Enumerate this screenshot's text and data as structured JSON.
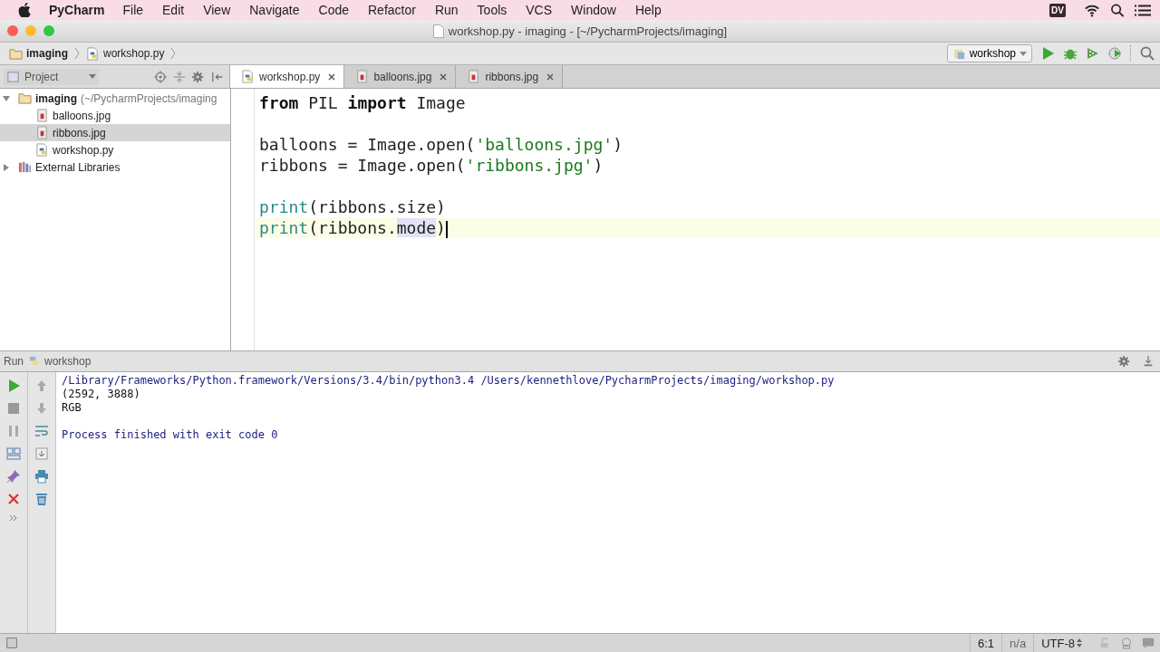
{
  "menu_bar": {
    "app": "PyCharm",
    "items": [
      "File",
      "Edit",
      "View",
      "Navigate",
      "Code",
      "Refactor",
      "Run",
      "Tools",
      "VCS",
      "Window",
      "Help"
    ],
    "badge": "DV"
  },
  "window": {
    "title": "workshop.py - imaging - [~/PycharmProjects/imaging]"
  },
  "breadcrumbs": [
    {
      "label": "imaging",
      "kind": "folder"
    },
    {
      "label": "workshop.py",
      "kind": "python"
    }
  ],
  "run_config": {
    "label": "workshop"
  },
  "project_panel": {
    "title": "Project"
  },
  "tabs": [
    {
      "label": "workshop.py",
      "kind": "python",
      "selected": true
    },
    {
      "label": "balloons.jpg",
      "kind": "image",
      "selected": false
    },
    {
      "label": "ribbons.jpg",
      "kind": "image",
      "selected": false
    }
  ],
  "tree": [
    {
      "label": "imaging",
      "path": "(~/PycharmProjects/imaging",
      "kind": "folder",
      "expanded": true,
      "selected": false,
      "children": [
        {
          "label": "balloons.jpg",
          "kind": "image",
          "selected": false
        },
        {
          "label": "ribbons.jpg",
          "kind": "image",
          "selected": true
        },
        {
          "label": "workshop.py",
          "kind": "python",
          "selected": false
        }
      ]
    },
    {
      "label": "External Libraries",
      "kind": "library",
      "expanded": false,
      "selected": false
    }
  ],
  "code_lines": [
    {
      "kind": "code",
      "current": false,
      "tokens": [
        {
          "text": "from",
          "kind": "keyword"
        },
        {
          "text": " PIL ",
          "kind": "plain"
        },
        {
          "text": "import",
          "kind": "keyword"
        },
        {
          "text": " Image",
          "kind": "plain"
        }
      ]
    },
    {
      "kind": "blank",
      "current": false
    },
    {
      "kind": "code",
      "current": false,
      "tokens": [
        {
          "text": "balloons = Image.open(",
          "kind": "plain"
        },
        {
          "text": "'balloons.jpg'",
          "kind": "string"
        },
        {
          "text": ")",
          "kind": "plain"
        }
      ]
    },
    {
      "kind": "code",
      "current": false,
      "tokens": [
        {
          "text": "ribbons = Image.open(",
          "kind": "plain"
        },
        {
          "text": "'ribbons.jpg'",
          "kind": "string"
        },
        {
          "text": ")",
          "kind": "plain"
        }
      ]
    },
    {
      "kind": "blank",
      "current": false
    },
    {
      "kind": "code",
      "current": false,
      "tokens": [
        {
          "text": "print",
          "kind": "builtin"
        },
        {
          "text": "(ribbons.size)",
          "kind": "plain"
        }
      ]
    },
    {
      "kind": "code",
      "current": true,
      "tokens": [
        {
          "text": "print",
          "kind": "builtin"
        },
        {
          "text": "(ribbons.",
          "kind": "plain"
        },
        {
          "text": "mode",
          "kind": "highlight"
        },
        {
          "text": ")",
          "kind": "plain"
        }
      ]
    }
  ],
  "run_panel": {
    "title": "Run",
    "config": "workshop"
  },
  "console_lines": [
    {
      "text": "/Library/Frameworks/Python.framework/Versions/3.4/bin/python3.4 /Users/kennethlove/PycharmProjects/imaging/workshop.py",
      "kind": "system"
    },
    {
      "text": "(2592, 3888)",
      "kind": "output"
    },
    {
      "text": "RGB",
      "kind": "output"
    },
    {
      "kind": "blank"
    },
    {
      "text": "Process finished with exit code 0",
      "kind": "system"
    }
  ],
  "status_bar": {
    "position": "6:1",
    "line_sep": "n/a",
    "encoding": "UTF-8"
  }
}
